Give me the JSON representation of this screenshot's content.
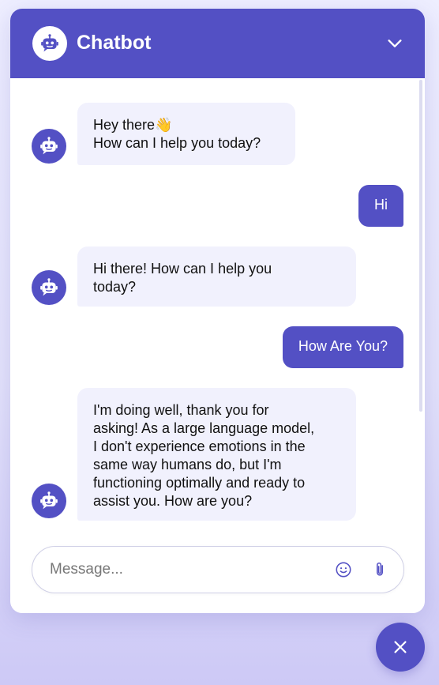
{
  "header": {
    "title": "Chatbot",
    "avatar_icon": "robot-icon",
    "collapse_icon": "chevron-down-icon"
  },
  "messages": [
    {
      "role": "bot",
      "lines": [
        "Hey there👋",
        "How can I help you today?"
      ]
    },
    {
      "role": "user",
      "text": "Hi"
    },
    {
      "role": "bot",
      "lines": [
        "Hi there! How can I help you",
        "today?"
      ]
    },
    {
      "role": "user",
      "text": "How Are You?"
    },
    {
      "role": "bot",
      "lines": [
        "I'm doing well, thank you for",
        "asking! As a large language model,",
        "I don't experience emotions in the",
        "same way humans do, but I'm",
        "functioning optimally and ready to",
        "assist you. How are you?"
      ]
    }
  ],
  "composer": {
    "placeholder": "Message...",
    "value": "",
    "emoji_icon": "smiley-icon",
    "attach_icon": "paperclip-icon"
  },
  "toggle": {
    "icon": "close-icon"
  },
  "colors": {
    "primary": "#5350c4",
    "bot_bubble": "#f1f1fd",
    "background": "#eeeeff"
  }
}
